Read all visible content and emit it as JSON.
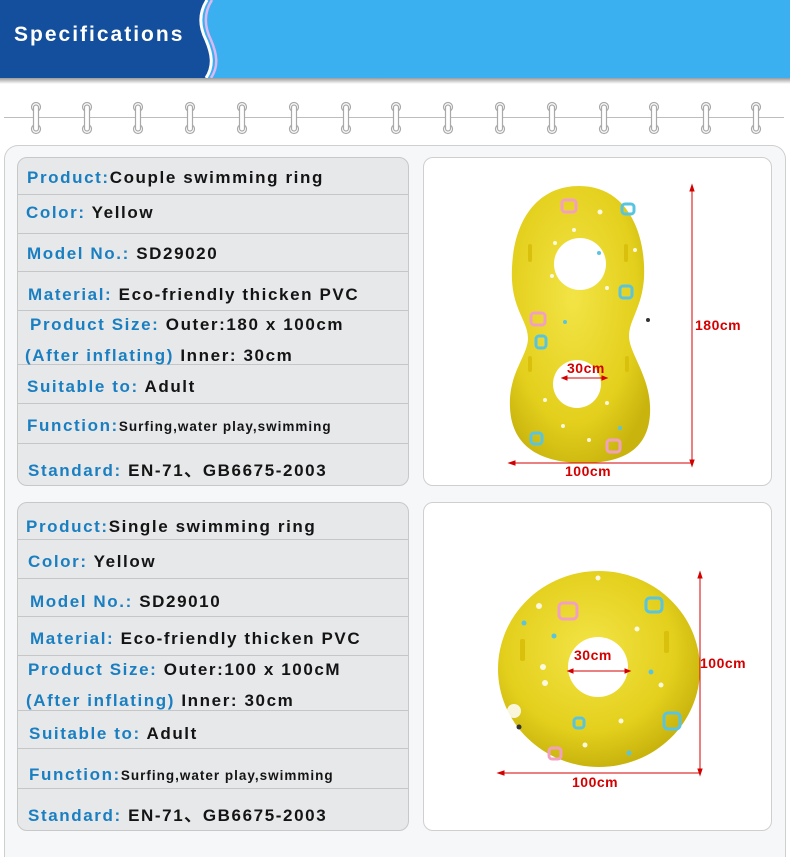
{
  "header": {
    "title": "Specifications"
  },
  "colors": {
    "banner_dark": "#134f9c",
    "banner_light": "#3ab0f0",
    "label_blue": "#1a7fc1",
    "dimension_red": "#d40000",
    "ring_yellow": "#e8d21f"
  },
  "products": [
    {
      "rows": [
        {
          "label": "Product:",
          "value": "Couple swimming ring"
        },
        {
          "label": "Color: ",
          "value": "Yellow"
        },
        {
          "label": "Model No.: ",
          "value": "SD29020"
        },
        {
          "label": "Material: ",
          "value": "Eco-friendly thicken PVC"
        },
        {
          "label": "Product Size: ",
          "value": "Outer:180 x 100cm",
          "label2": "(After inflating) ",
          "value2": "Inner: 30cm"
        },
        {
          "label": "Suitable to: ",
          "value": "Adult"
        },
        {
          "label": "Function:",
          "value": "Surfing,water play,swimming"
        },
        {
          "label": "Standard: ",
          "value": "EN-71、GB6675-2003"
        }
      ],
      "image": {
        "alt": "Yellow figure-eight couple swimming ring",
        "dim_height": "180cm",
        "dim_width": "100cm",
        "dim_inner": "30cm"
      }
    },
    {
      "rows": [
        {
          "label": "Product:",
          "value": "Single swimming ring"
        },
        {
          "label": "Color: ",
          "value": "Yellow"
        },
        {
          "label": "Model No.: ",
          "value": "SD29010"
        },
        {
          "label": "Material: ",
          "value": "Eco-friendly thicken PVC"
        },
        {
          "label": "Product Size: ",
          "value": "Outer:100 x 100cM",
          "label2": "(After inflating) ",
          "value2": "Inner: 30cm"
        },
        {
          "label": "Suitable to: ",
          "value": "Adult"
        },
        {
          "label": "Function:",
          "value": "Surfing,water play,swimming"
        },
        {
          "label": "Standard: ",
          "value": "EN-71、GB6675-2003"
        }
      ],
      "image": {
        "alt": "Yellow round single swimming ring",
        "dim_height": "100cm",
        "dim_width": "100cm",
        "dim_inner": "30cm"
      }
    }
  ]
}
